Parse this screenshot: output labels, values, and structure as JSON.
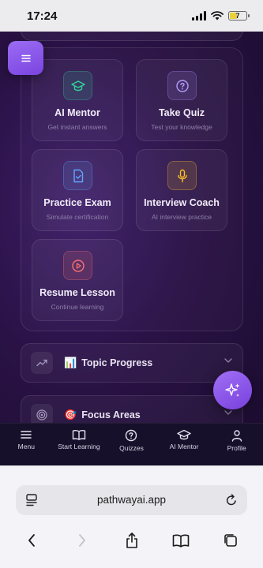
{
  "status_bar": {
    "time": "17:24",
    "battery": "7"
  },
  "tiles": [
    {
      "title": "AI Mentor",
      "subtitle": "Get instant answers",
      "icon": "graduation-cap-icon"
    },
    {
      "title": "Take Quiz",
      "subtitle": "Test your knowledge",
      "icon": "question-circle-icon"
    },
    {
      "title": "Practice Exam",
      "subtitle": "Simulate certification",
      "icon": "document-check-icon"
    },
    {
      "title": "Interview Coach",
      "subtitle": "AI interview practice",
      "icon": "microphone-icon"
    },
    {
      "title": "Resume Lesson",
      "subtitle": "Continue learning",
      "icon": "play-circle-icon"
    }
  ],
  "sections": [
    {
      "emoji": "📊",
      "label": "Topic Progress",
      "icon": "trend-up-icon"
    },
    {
      "emoji": "🎯",
      "label": "Focus Areas",
      "icon": "target-icon"
    }
  ],
  "nav": [
    {
      "label": "Menu",
      "icon": "menu-icon"
    },
    {
      "label": "Start Learning",
      "icon": "book-icon"
    },
    {
      "label": "Quizzes",
      "icon": "question-circle-icon"
    },
    {
      "label": "AI Mentor",
      "icon": "graduation-cap-icon"
    },
    {
      "label": "Profile",
      "icon": "user-icon"
    }
  ],
  "browser": {
    "url": "pathwayai.app"
  },
  "colors": {
    "accent": "#8b5cf6",
    "background": "#2a1246",
    "mentor_icon": "#34d399",
    "quiz_icon": "#a78bfa",
    "exam_icon": "#60a5fa",
    "coach_icon": "#fbbf24",
    "resume_icon": "#f87171"
  }
}
